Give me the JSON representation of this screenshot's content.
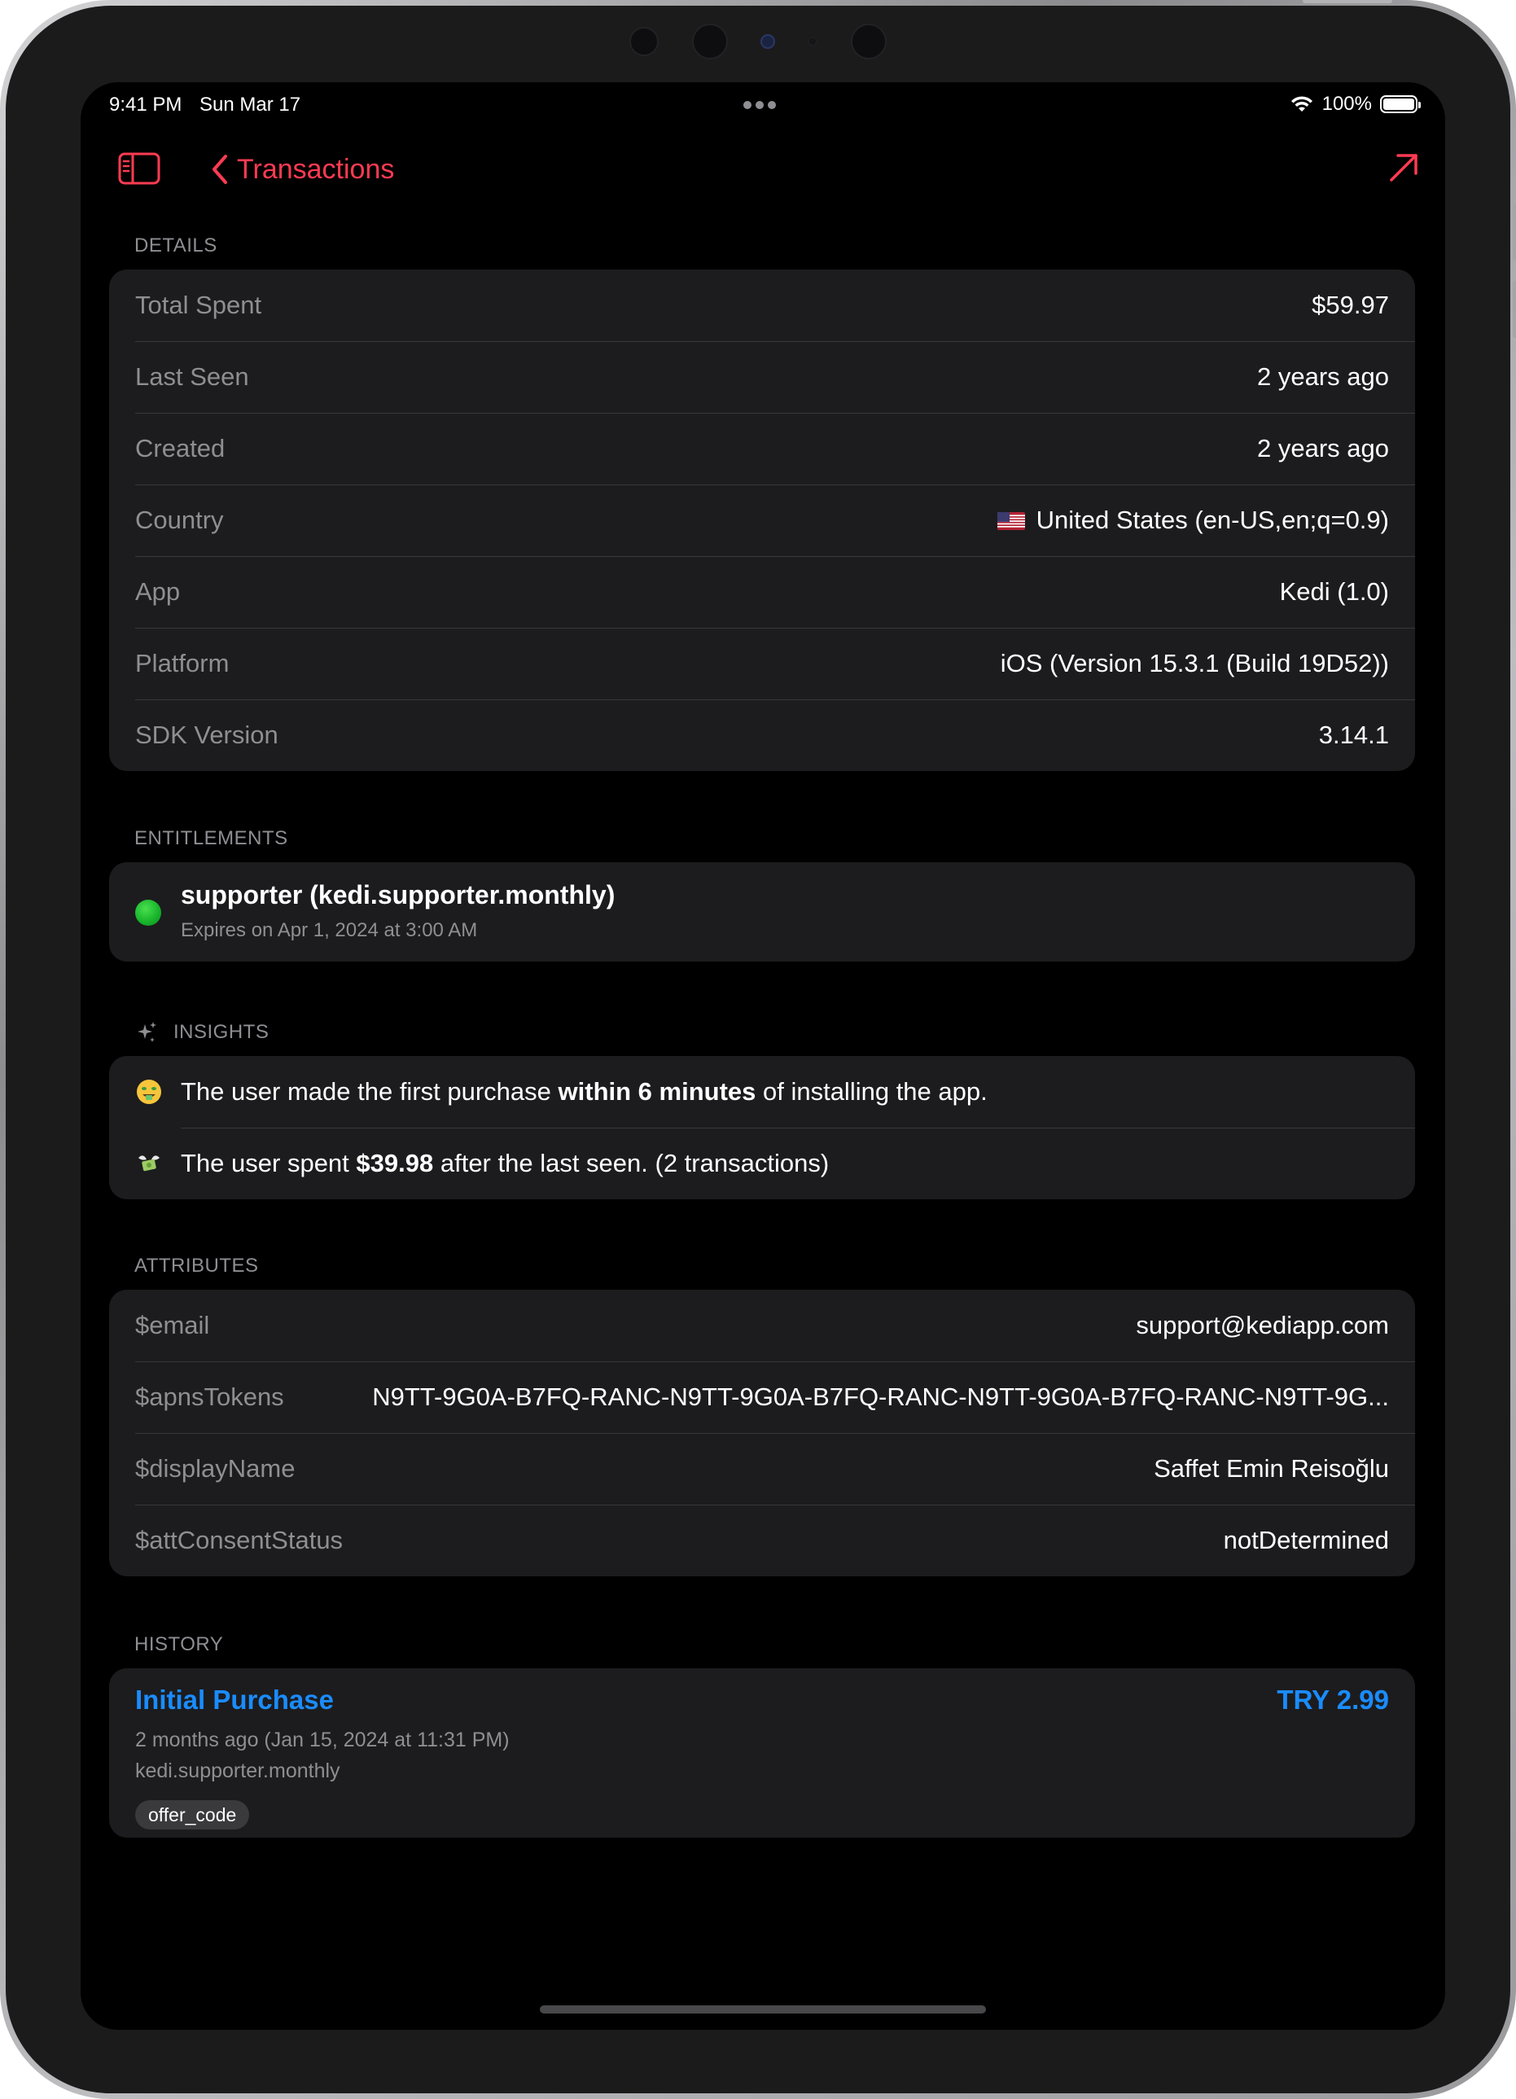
{
  "status_bar": {
    "time": "9:41 PM",
    "date": "Sun Mar 17",
    "battery": "100%"
  },
  "nav": {
    "back_label": "Transactions"
  },
  "details": {
    "header": "DETAILS",
    "rows": [
      {
        "label": "Total Spent",
        "value": "$59.97"
      },
      {
        "label": "Last Seen",
        "value": "2 years ago"
      },
      {
        "label": "Created",
        "value": "2 years ago"
      },
      {
        "label": "Country",
        "value": "United States (en-US,en;q=0.9)"
      },
      {
        "label": "App",
        "value": "Kedi (1.0)"
      },
      {
        "label": "Platform",
        "value": "iOS (Version 15.3.1 (Build 19D52))"
      },
      {
        "label": "SDK Version",
        "value": "3.14.1"
      }
    ]
  },
  "entitlements": {
    "header": "ENTITLEMENTS",
    "items": [
      {
        "title": "supporter (kedi.supporter.monthly)",
        "subtitle": "Expires on Apr 1, 2024 at 3:00 AM",
        "status_color": "#19b52c"
      }
    ]
  },
  "insights": {
    "header": "INSIGHTS",
    "items": [
      {
        "icon": "money-mouth-face-icon",
        "text_before": "The user made the first purchase ",
        "bold": "within 6 minutes",
        "text_after": " of installing the app."
      },
      {
        "icon": "money-with-wings-icon",
        "text_before": "The user spent ",
        "bold": "$39.98",
        "text_after": " after the last seen. (2 transactions)"
      }
    ]
  },
  "attributes": {
    "header": "ATTRIBUTES",
    "rows": [
      {
        "label": "$email",
        "value": "support@kediapp.com"
      },
      {
        "label": "$apnsTokens",
        "value": "N9TT-9G0A-B7FQ-RANC-N9TT-9G0A-B7FQ-RANC-N9TT-9G0A-B7FQ-RANC-N9TT-9G..."
      },
      {
        "label": "$displayName",
        "value": "Saffet Emin Reisoğlu"
      },
      {
        "label": "$attConsentStatus",
        "value": "notDetermined"
      }
    ]
  },
  "history": {
    "header": "HISTORY",
    "items": [
      {
        "title": "Initial Purchase",
        "price": "TRY 2.99",
        "date": "2 months ago (Jan 15, 2024 at 11:31 PM)",
        "product": "kedi.supporter.monthly",
        "tag": "offer_code"
      }
    ]
  },
  "colors": {
    "accent": "#ff3b52",
    "link": "#1a8cff",
    "card": "#1c1c1e",
    "secondary_text": "#8e8e93"
  }
}
